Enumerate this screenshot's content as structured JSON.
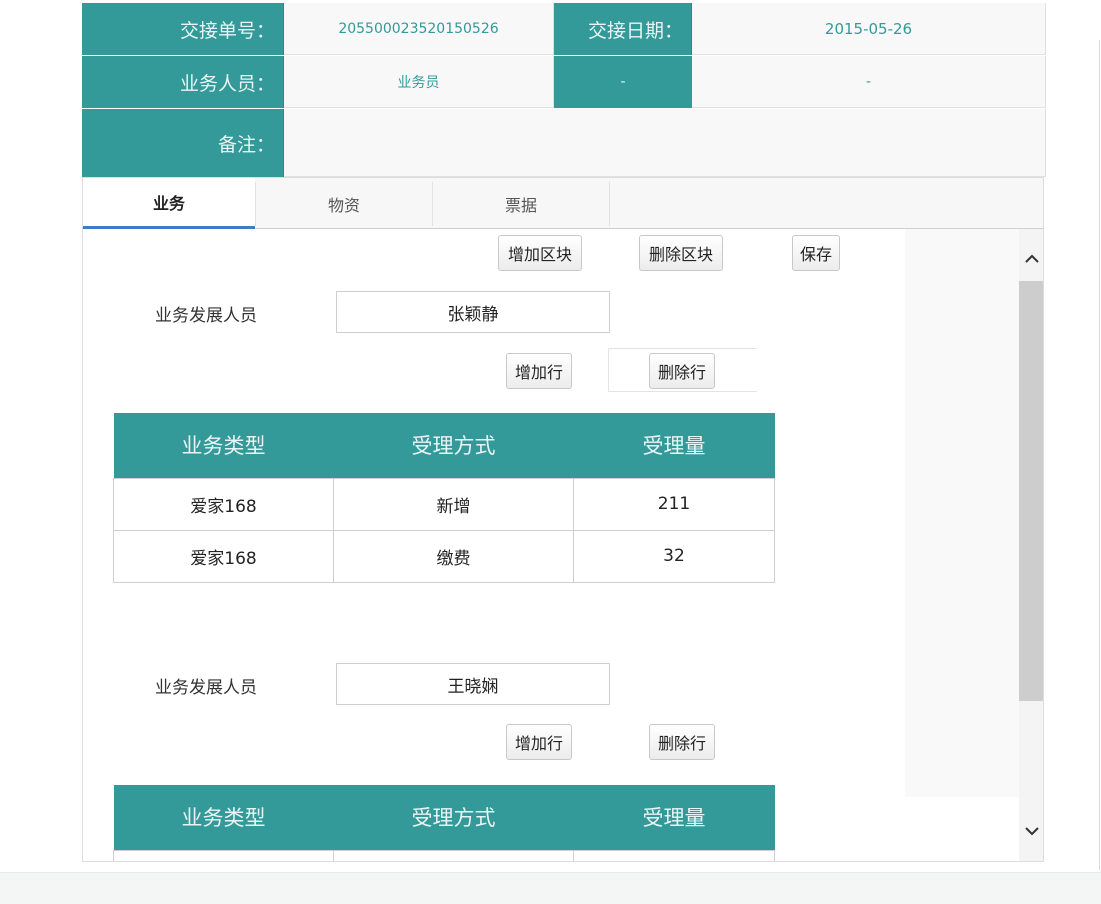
{
  "header": {
    "handover_no_label": "交接单号：",
    "handover_no_value": "205500023520150526",
    "handover_date_label": "交接日期：",
    "handover_date_value": "2015-05-26",
    "staff_label": "业务人员：",
    "staff_value": "业务员",
    "extra_label": "-",
    "extra_value": "-",
    "remark_label": "备注：",
    "remark_value": ""
  },
  "tabs": [
    {
      "label": "业务",
      "active": true
    },
    {
      "label": "物资",
      "active": false
    },
    {
      "label": "票据",
      "active": false
    }
  ],
  "toolbar": {
    "add_block": "增加区块",
    "delete_block": "删除区块",
    "save": "保存"
  },
  "blocks": [
    {
      "person_label": "业务发展人员",
      "person_value": "张颖静",
      "add_row": "增加行",
      "delete_row": "删除行",
      "columns": [
        "业务类型",
        "受理方式",
        "受理量"
      ],
      "rows": [
        [
          "爱家168",
          "新增",
          "211"
        ],
        [
          "爱家168",
          "缴费",
          "32"
        ]
      ]
    },
    {
      "person_label": "业务发展人员",
      "person_value": "王晓娴",
      "add_row": "增加行",
      "delete_row": "删除行",
      "columns": [
        "业务类型",
        "受理方式",
        "受理量"
      ],
      "rows": []
    }
  ],
  "scrollbar": {
    "up_icon": "chevron-up-icon",
    "down_icon": "chevron-down-icon",
    "position": 0.0
  },
  "colors": {
    "accent": "#339999",
    "tab_underline": "#3d7cc9"
  }
}
